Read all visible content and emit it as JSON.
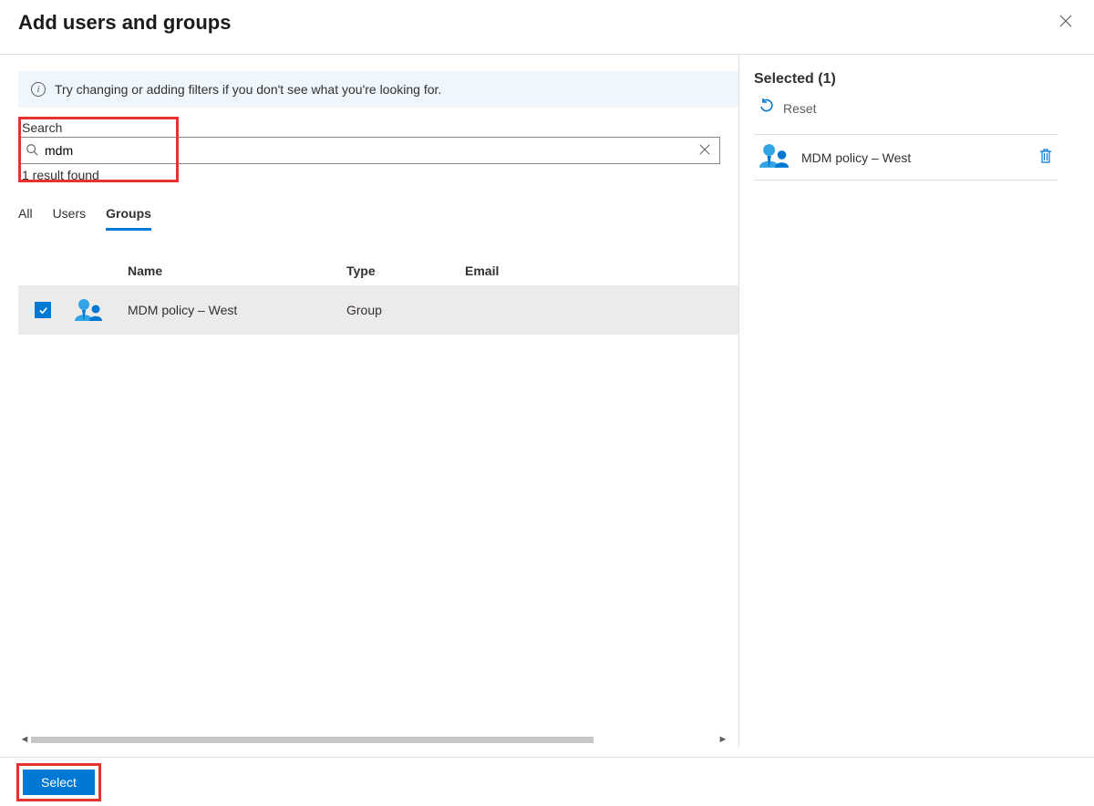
{
  "header": {
    "title": "Add users and groups"
  },
  "info_banner": {
    "text": "Try changing or adding filters if you don't see what you're looking for."
  },
  "search": {
    "label": "Search",
    "value": "mdm",
    "result_text": "1 result found"
  },
  "tabs": {
    "all": "All",
    "users": "Users",
    "groups": "Groups"
  },
  "table": {
    "headers": {
      "name": "Name",
      "type": "Type",
      "email": "Email"
    },
    "rows": [
      {
        "name": "MDM policy – West",
        "type": "Group",
        "email": "",
        "checked": true
      }
    ]
  },
  "selected_panel": {
    "title": "Selected (1)",
    "reset_label": "Reset",
    "items": [
      {
        "name": "MDM policy – West"
      }
    ]
  },
  "footer": {
    "select_label": "Select"
  }
}
